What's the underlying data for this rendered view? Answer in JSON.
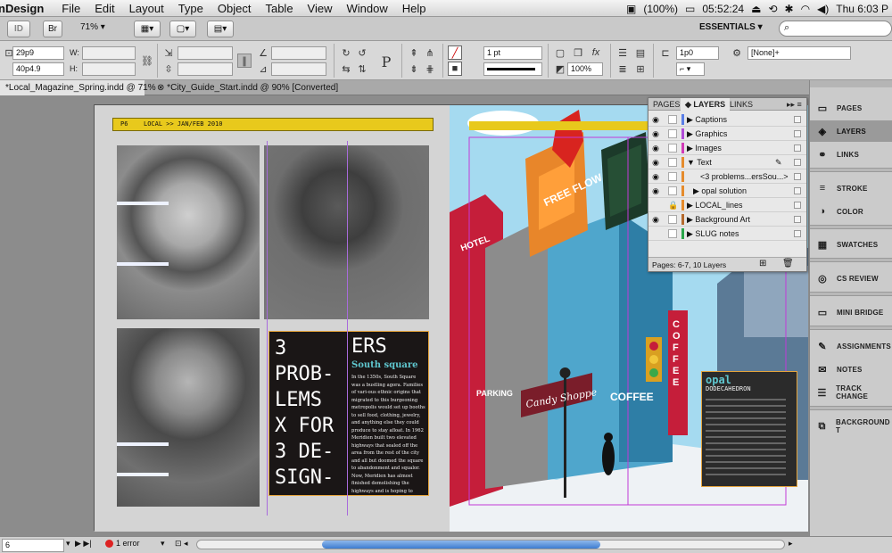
{
  "menubar": {
    "app_name": "nDesign",
    "menus": [
      "File",
      "Edit",
      "Layout",
      "Type",
      "Object",
      "Table",
      "View",
      "Window",
      "Help"
    ],
    "battery": "(100%)",
    "time": "05:52:24",
    "clock": "Thu 6:03 P"
  },
  "appbar": {
    "br_label": "Br",
    "zoom": "71%",
    "workspace": "ESSENTIALS",
    "search_placeholder": ""
  },
  "control": {
    "x": "29p9",
    "y": "40p4.9",
    "w_label": "W:",
    "h_label": "H:",
    "stroke_weight": "1 pt",
    "opacity": "100%",
    "offset": "1p0",
    "object_style": "[None]+"
  },
  "tabs": [
    {
      "label": "*Local_Magazine_Spring.indd @ 71%"
    },
    {
      "label": "*City_Guide_Start.indd @ 90% [Converted]"
    }
  ],
  "page": {
    "folio": "P6",
    "header": "LOCAL >> JAN/FEB 2010",
    "headline_lines": [
      "3",
      "PROB-",
      "LEMS",
      "X FOR",
      "3 DE-",
      "SIGN-"
    ],
    "ers": "ERS",
    "subhead": "South square",
    "body": "In the 1350s, South Square was a bustling agora. Families of vari-ous ethnic origins that migrated to this burgeoning metropolis would set up booths to sell food, clothing, jewelry, and anything else they could produce to stay afloat. In 1962 Meridien built two elevated highways that sealed off the area from the rest of the city and all but doomed the square to abandonment and squalor. Now, Meridien has almost finished demolishing the highways and is hoping to revitalize the area. Local entre-",
    "sidebar_title": "opal",
    "sidebar_subtitle": "DODECAHEDRON"
  },
  "illustration": {
    "free_sign": "FREE FLOW",
    "hotel": "HOTEL",
    "parking": "PARKING",
    "candy": "Candy Shoppe",
    "coffee_vertical": "COFFEE",
    "coffee_store": "COFFEE"
  },
  "layers_panel": {
    "tabs": [
      "PAGES",
      "LAYERS",
      "LINKS"
    ],
    "rows": [
      {
        "name": "Captions",
        "color": "#5a7ee6"
      },
      {
        "name": "Graphics",
        "color": "#b04bd8"
      },
      {
        "name": "Images",
        "color": "#d23cb8"
      },
      {
        "name": "Text",
        "color": "#e58b2c"
      },
      {
        "name": "<3 problems...ersSou...>",
        "color": "#e58b2c"
      },
      {
        "name": "opal solution",
        "color": "#e58b2c"
      },
      {
        "name": "LOCAL_lines",
        "color": "#e58b2c"
      },
      {
        "name": "Background Art",
        "color": "#b56a2e"
      },
      {
        "name": "SLUG notes",
        "color": "#2aa64a"
      }
    ],
    "footer": "Pages: 6-7, 10 Layers"
  },
  "dock": {
    "items": [
      "PAGES",
      "LAYERS",
      "LINKS",
      "STROKE",
      "COLOR",
      "SWATCHES",
      "CS REVIEW",
      "MINI BRIDGE",
      "ASSIGNMENTS",
      "NOTES",
      "TRACK CHANGE",
      "BACKGROUND T"
    ]
  },
  "status": {
    "page": "6",
    "errors": "1 error"
  }
}
